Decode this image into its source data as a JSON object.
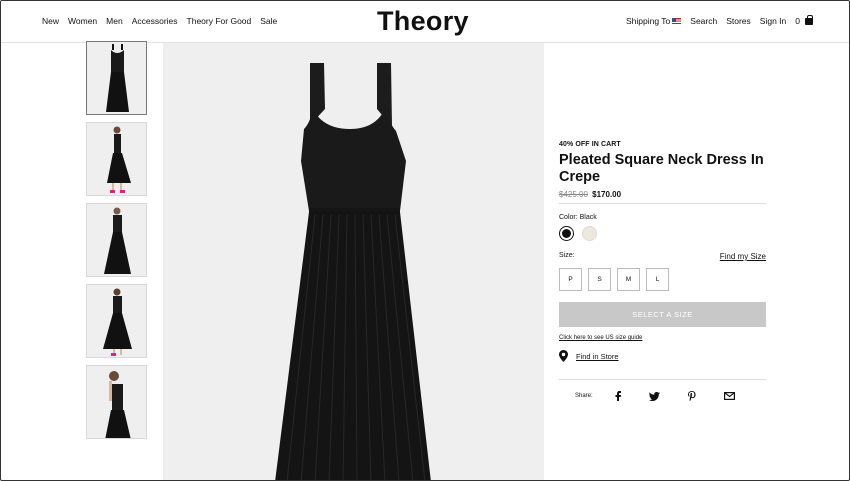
{
  "header": {
    "nav_left": [
      "New",
      "Women",
      "Men",
      "Accessories",
      "Theory For Good",
      "Sale"
    ],
    "logo": "Theory",
    "shipping_label": "Shipping To",
    "search_label": "Search",
    "stores_label": "Stores",
    "signin_label": "Sign In",
    "cart_count": "0"
  },
  "product": {
    "promo": "40% OFF IN CART",
    "title": "Pleated Square Neck Dress In Crepe",
    "price_old": "$425.00",
    "price_new": "$170.00",
    "color_label": "Color: Black",
    "colors": [
      "#111111",
      "#ede7df"
    ],
    "size_label": "Size:",
    "find_size": "Find my Size",
    "sizes": [
      "P",
      "S",
      "M",
      "L"
    ],
    "select_button": "SELECT A SIZE",
    "size_guide": "Click here to see US size guide",
    "find_store": "Find in Store",
    "share_label": "Share:"
  },
  "icons": {
    "share": [
      "facebook-icon",
      "twitter-icon",
      "pinterest-icon",
      "email-icon"
    ],
    "location": "location-pin-icon",
    "bag": "shopping-bag-icon",
    "flag": "us-flag-icon"
  }
}
